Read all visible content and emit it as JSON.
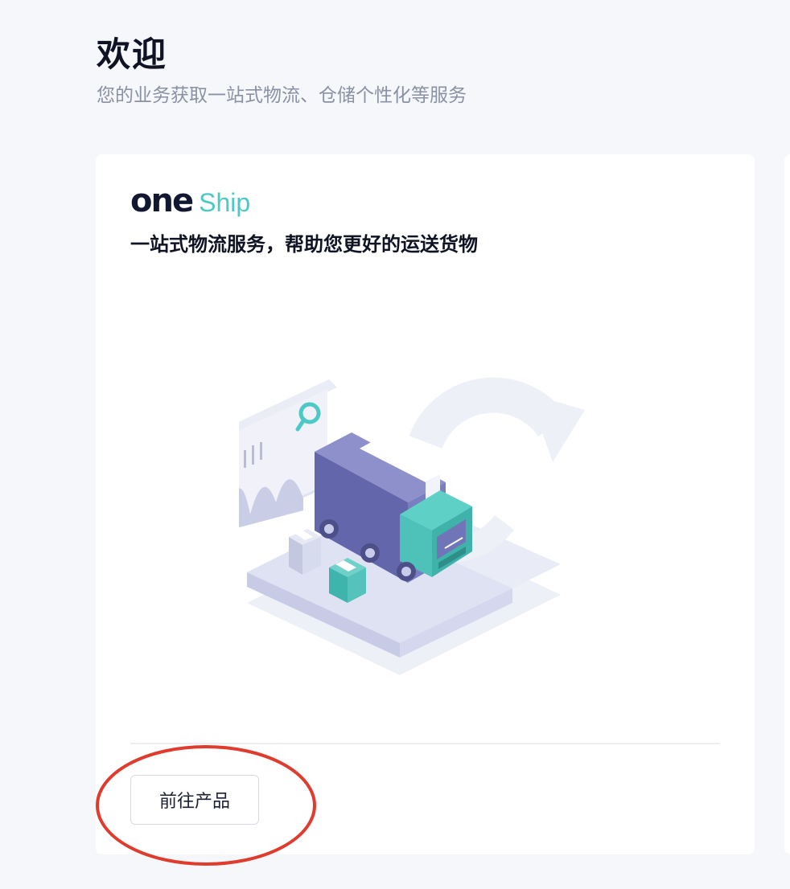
{
  "header": {
    "title": "欢迎",
    "subtitle": "您的业务获取一站式物流、仓储个性化等服务"
  },
  "card": {
    "logo": {
      "part1": "one",
      "part2": "Ship"
    },
    "tagline": "一站式物流服务，帮助您更好的运送货物",
    "illustration": "delivery-truck-illustration",
    "button_label": "前往产品"
  },
  "annotation": {
    "type": "red-circle",
    "color": "#e03c2e"
  },
  "colors": {
    "background": "#f5f7fb",
    "brand_dark": "#131832",
    "brand_teal": "#4cc9c4",
    "truck_purple": "#6b6fb5"
  }
}
